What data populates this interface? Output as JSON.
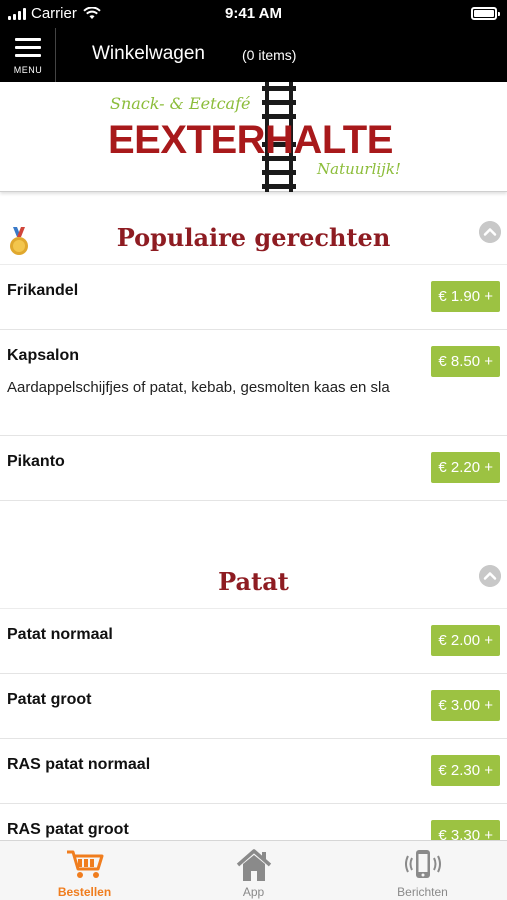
{
  "status_bar": {
    "carrier": "Carrier",
    "time": "9:41 AM",
    "battery_level": 1.0
  },
  "header": {
    "menu_label": "MENU",
    "title": "Winkelwagen",
    "items_count": "(0 items)"
  },
  "logo": {
    "tagline_top": "Snack- & Eetcafé",
    "name": "EEXTERHALTE",
    "tagline_bottom": "Natuurlijk!"
  },
  "sections": [
    {
      "title": "Populaire gerechten",
      "icon": "medal-icon",
      "items": [
        {
          "name": "Frikandel",
          "description": "",
          "price": "€ 1.90 +"
        },
        {
          "name": "Kapsalon",
          "description": "Aardappelschijfjes of patat, kebab, gesmolten kaas en sla",
          "price": "€ 8.50 +"
        },
        {
          "name": "Pikanto",
          "description": "",
          "price": "€ 2.20 +"
        }
      ]
    },
    {
      "title": "Patat",
      "icon": "",
      "items": [
        {
          "name": "Patat normaal",
          "description": "",
          "price": "€ 2.00 +"
        },
        {
          "name": "Patat groot",
          "description": "",
          "price": "€ 3.00 +"
        },
        {
          "name": "RAS patat normaal",
          "description": "",
          "price": "€ 2.30 +"
        },
        {
          "name": "RAS patat groot",
          "description": "",
          "price": "€ 3.30 +"
        }
      ]
    }
  ],
  "tabbar": {
    "tabs": [
      {
        "label": "Bestellen",
        "icon": "cart-icon",
        "active": true
      },
      {
        "label": "App",
        "icon": "home-icon",
        "active": false
      },
      {
        "label": "Berichten",
        "icon": "phone-vibrate-icon",
        "active": false
      }
    ]
  },
  "colors": {
    "accent_orange": "#f07d1e",
    "price_green": "#9cc242",
    "section_red": "#8e1c22",
    "logo_red": "#a8191b",
    "logo_green": "#8cbd3a"
  }
}
